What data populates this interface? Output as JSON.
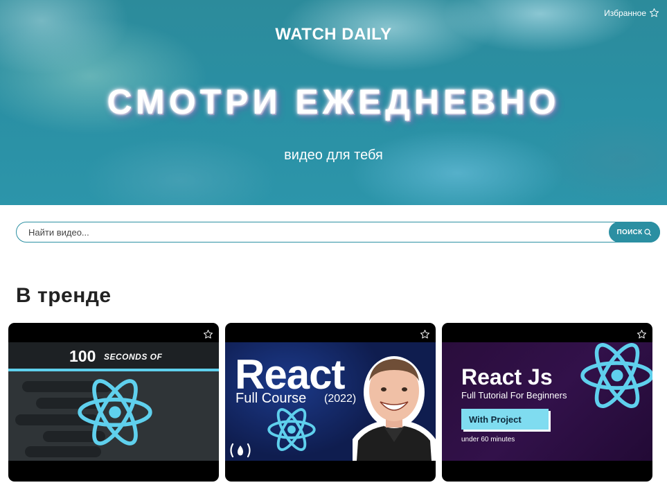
{
  "header": {
    "favorites_label": "Избранное",
    "brand": "WATCH DAILY",
    "title": "СМОТРИ ЕЖЕДНЕВНО",
    "subtitle": "видео для тебя"
  },
  "search": {
    "placeholder": "Найти видео...",
    "button_label": "ПОИСК"
  },
  "trending": {
    "heading": "В тренде",
    "cards": [
      {
        "thumb_text": [
          "100",
          "SECONDS OF"
        ],
        "icons": [
          "react-logo-icon",
          "star-icon"
        ]
      },
      {
        "thumb_text": [
          "React",
          "Full Course",
          "(2022)"
        ],
        "icons": [
          "react-logo-icon",
          "freecodecamp-icon",
          "star-icon"
        ]
      },
      {
        "thumb_text": [
          "React Js",
          "Full Tutorial For Beginners",
          "With Project",
          "under 60 minutes"
        ],
        "icons": [
          "react-logo-icon",
          "star-icon"
        ]
      }
    ]
  },
  "colors": {
    "accent": "#2b8fa2",
    "react_cyan": "#5fd0ed"
  }
}
